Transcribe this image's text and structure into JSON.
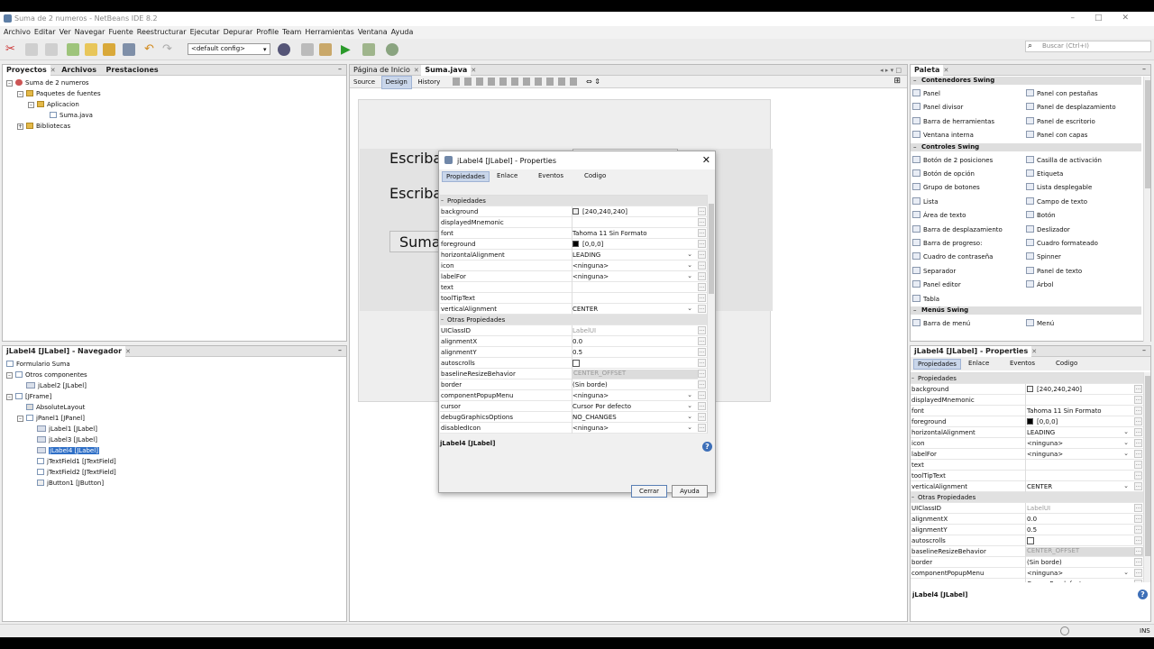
{
  "window": {
    "title": "Suma de 2 numeros - NetBeans IDE 8.2"
  },
  "menu": [
    "Archivo",
    "Editar",
    "Ver",
    "Navegar",
    "Fuente",
    "Reestructurar",
    "Ejecutar",
    "Depurar",
    "Profile",
    "Team",
    "Herramientas",
    "Ventana",
    "Ayuda"
  ],
  "toolbar": {
    "config": "<default config>",
    "search_placeholder": "Buscar (Ctrl+I)"
  },
  "projects": {
    "tabs": [
      "Proyectos",
      "Archivos",
      "Prestaciones"
    ],
    "tree": [
      "Suma de 2 numeros",
      "Paquetes de fuentes",
      "Aplicacion",
      "Suma.java",
      "Bibliotecas"
    ]
  },
  "navigator": {
    "title": "jLabel4 [JLabel] - Navegador",
    "tree": [
      "Formulario Suma",
      "Otros componentes",
      "jLabel2 [JLabel]",
      "[JFrame]",
      "AbsoluteLayout",
      "jPanel1 [JPanel]",
      "jLabel1 [JLabel]",
      "jLabel3 [JLabel]",
      "jLabel4 [JLabel]",
      "jTextField1 [JTextField]",
      "jTextField2 [JTextField]",
      "jButton1 [JButton]"
    ]
  },
  "editor": {
    "tabs": [
      "Página de Inicio",
      "Suma.java"
    ],
    "views": [
      "Source",
      "Design",
      "History"
    ],
    "form": {
      "label1": "Escriba su primer numero:",
      "label2": "Escriba",
      "button": "Sumar"
    }
  },
  "dialog": {
    "title": "jLabel4 [JLabel] - Properties",
    "tabs": [
      "Propiedades",
      "Enlace",
      "Eventos",
      "Codigo"
    ],
    "footer": "jLabel4 [JLabel]",
    "close": "Cerrar",
    "help": "Ayuda"
  },
  "props": [
    {
      "k": "Propiedades",
      "cat": true
    },
    {
      "k": "background",
      "v": "[240,240,240]",
      "sw": "#f0f0f0"
    },
    {
      "k": "displayedMnemonic",
      "v": ""
    },
    {
      "k": "font",
      "v": "Tahoma 11 Sin Formato"
    },
    {
      "k": "foreground",
      "v": "[0,0,0]",
      "sw": "#000000"
    },
    {
      "k": "horizontalAlignment",
      "v": "LEADING",
      "dd": true
    },
    {
      "k": "icon",
      "v": "<ninguna>",
      "dd": true
    },
    {
      "k": "labelFor",
      "v": "<ninguna>",
      "dd": true
    },
    {
      "k": "text",
      "v": ""
    },
    {
      "k": "toolTipText",
      "v": ""
    },
    {
      "k": "verticalAlignment",
      "v": "CENTER",
      "dd": true
    },
    {
      "k": "Otras Propiedades",
      "cat": true
    },
    {
      "k": "UIClassID",
      "v": "LabelUI",
      "gray": true
    },
    {
      "k": "alignmentX",
      "v": "0.0"
    },
    {
      "k": "alignmentY",
      "v": "0.5"
    },
    {
      "k": "autoscrolls",
      "v": "",
      "chk": true
    },
    {
      "k": "baselineResizeBehavior",
      "v": "CENTER_OFFSET",
      "grayfill": true
    },
    {
      "k": "border",
      "v": "(Sin borde)"
    },
    {
      "k": "componentPopupMenu",
      "v": "<ninguna>",
      "dd": true
    },
    {
      "k": "cursor",
      "v": "Cursor Por defecto",
      "dd": true
    },
    {
      "k": "debugGraphicsOptions",
      "v": "NO_CHANGES",
      "dd": true
    },
    {
      "k": "disabledIcon",
      "v": "<ninguna>",
      "dd": true
    }
  ],
  "right_props": [
    {
      "k": "Propiedades",
      "cat": true
    },
    {
      "k": "background",
      "v": "[240,240,240]",
      "sw": "#f0f0f0"
    },
    {
      "k": "displayedMnemonic",
      "v": ""
    },
    {
      "k": "font",
      "v": "Tahoma 11 Sin Formato"
    },
    {
      "k": "foreground",
      "v": "[0,0,0]",
      "sw": "#000000"
    },
    {
      "k": "horizontalAlignment",
      "v": "LEADING",
      "dd": true
    },
    {
      "k": "icon",
      "v": "<ninguna>",
      "dd": true
    },
    {
      "k": "labelFor",
      "v": "<ninguna>",
      "dd": true
    },
    {
      "k": "text",
      "v": ""
    },
    {
      "k": "toolTipText",
      "v": ""
    },
    {
      "k": "verticalAlignment",
      "v": "CENTER",
      "dd": true
    },
    {
      "k": "Otras Propiedades",
      "cat": true
    },
    {
      "k": "UIClassID",
      "v": "LabelUI",
      "gray": true
    },
    {
      "k": "alignmentX",
      "v": "0.0"
    },
    {
      "k": "alignmentY",
      "v": "0.5"
    },
    {
      "k": "autoscrolls",
      "v": "",
      "chk": true
    },
    {
      "k": "baselineResizeBehavior",
      "v": "CENTER_OFFSET",
      "grayfill": true
    },
    {
      "k": "border",
      "v": "(Sin borde)"
    },
    {
      "k": "componentPopupMenu",
      "v": "<ninguna>",
      "dd": true
    },
    {
      "k": "cursor",
      "v": "Cursor Por defecto"
    }
  ],
  "right_panel": {
    "title": "jLabel4 [JLabel] - Properties",
    "tabs": [
      "Propiedades",
      "Enlace",
      "Eventos",
      "Codigo"
    ],
    "footer": "jLabel4 [JLabel]"
  },
  "palette": {
    "title": "Paleta",
    "containers": "Contenedores Swing",
    "container_items": [
      "Panel",
      "Panel con pestañas",
      "Panel divisor",
      "Panel de desplazamiento",
      "Barra de herramientas",
      "Panel de escritorio",
      "Ventana interna",
      "Panel con capas"
    ],
    "controls": "Controles Swing",
    "control_items": [
      "Botón de 2 posiciones",
      "Casilla de activación",
      "Botón de opción",
      "Etiqueta",
      "Grupo de botones",
      "Lista desplegable",
      "Lista",
      "Campo de texto",
      "Área de texto",
      "Botón",
      "Barra de desplazamiento",
      "Deslizador",
      "Barra de progreso:",
      "Cuadro formateado",
      "Cuadro de contraseña",
      "Spinner",
      "Separador",
      "Panel de texto",
      "Panel editor",
      "Árbol",
      "Tabla"
    ],
    "menus": "Menús Swing",
    "menu_items": [
      "Barra de menú",
      "Menú"
    ]
  },
  "status": {
    "ins": "INS"
  }
}
